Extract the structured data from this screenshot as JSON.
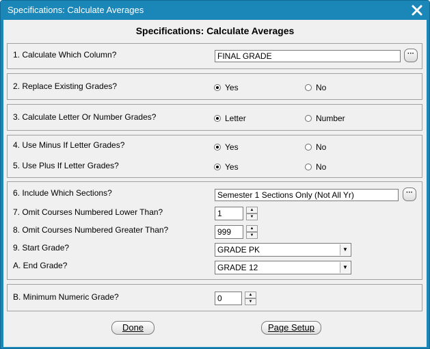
{
  "window": {
    "title": "Specifications: Calculate Averages"
  },
  "dialog": {
    "heading": "Specifications: Calculate Averages"
  },
  "q1": {
    "label": "1. Calculate Which Column?",
    "value": "FINAL GRADE",
    "browse": "···"
  },
  "q2": {
    "label": "2. Replace Existing Grades?",
    "opt_yes": "Yes",
    "opt_no": "No",
    "selected": "Yes"
  },
  "q3": {
    "label": "3. Calculate Letter Or Number Grades?",
    "opt_letter": "Letter",
    "opt_number": "Number",
    "selected": "Letter"
  },
  "q4": {
    "label": "4. Use Minus If Letter Grades?",
    "opt_yes": "Yes",
    "opt_no": "No",
    "selected": "Yes"
  },
  "q5": {
    "label": "5. Use Plus If Letter Grades?",
    "opt_yes": "Yes",
    "opt_no": "No",
    "selected": "Yes"
  },
  "q6": {
    "label": "6. Include Which Sections?",
    "value": "Semester 1 Sections Only (Not All Yr)",
    "browse": "···"
  },
  "q7": {
    "label": "7. Omit Courses Numbered Lower Than?",
    "value": "1"
  },
  "q8": {
    "label": "8. Omit Courses Numbered Greater Than?",
    "value": "999"
  },
  "q9": {
    "label": "9. Start Grade?",
    "value": "GRADE PK"
  },
  "qA": {
    "label": "A. End Grade?",
    "value": "GRADE 12"
  },
  "qB": {
    "label": "B. Minimum Numeric Grade?",
    "value": "0"
  },
  "buttons": {
    "done": "Done",
    "page_setup": "Page Setup"
  }
}
